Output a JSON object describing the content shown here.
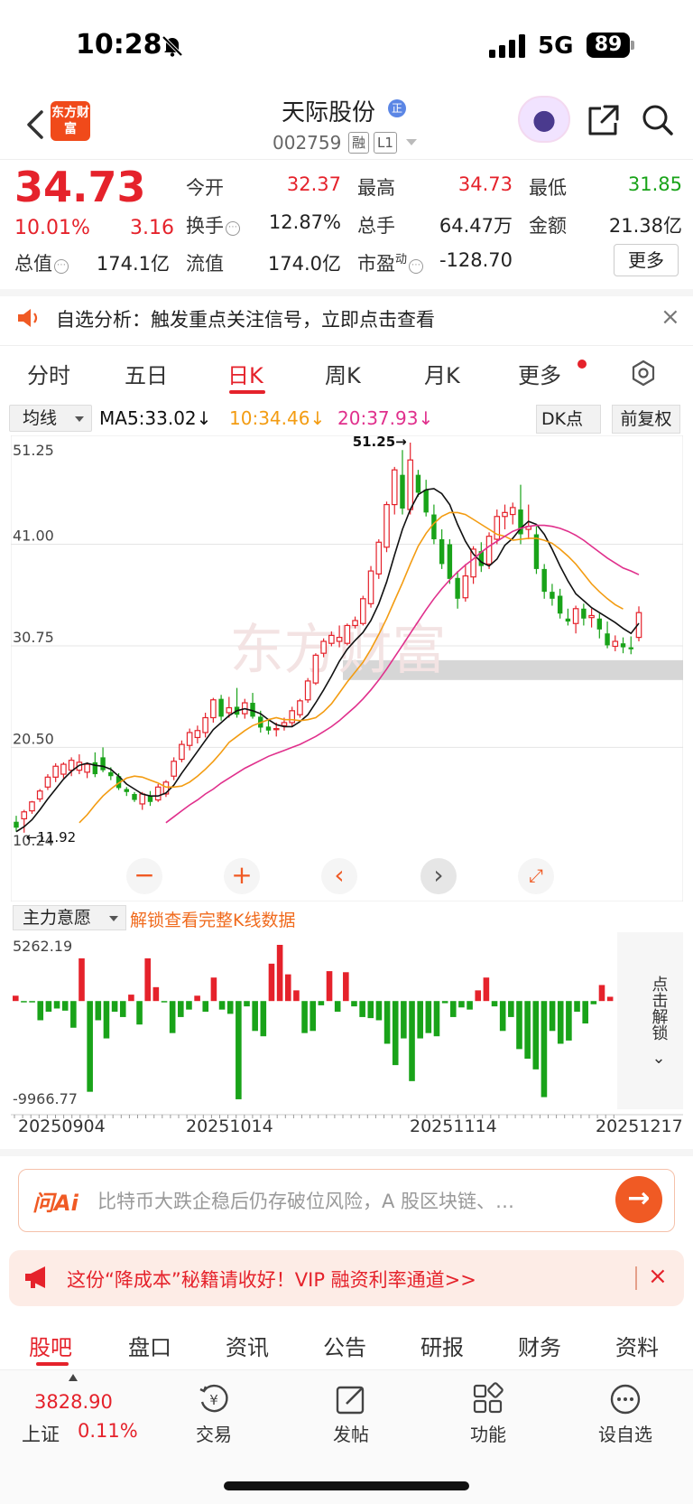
{
  "status_bar": {
    "time": "10:28",
    "network": "5G",
    "battery": "89"
  },
  "header": {
    "logo_text": "东方财富",
    "stock_name": "天际股份",
    "name_badge": "正",
    "stock_code": "002759",
    "tags": [
      "融",
      "L1"
    ]
  },
  "quote": {
    "price": "34.73",
    "change_pct": "10.01%",
    "change": "3.16",
    "fields": [
      {
        "label": "今开",
        "value": "32.37"
      },
      {
        "label": "最高",
        "value": "34.73"
      },
      {
        "label": "最低",
        "value": "31.85"
      },
      {
        "label": "换手",
        "value": "12.87%"
      },
      {
        "label": "总手",
        "value": "64.47万"
      },
      {
        "label": "金额",
        "value": "21.38亿"
      },
      {
        "label": "总值",
        "value": "174.1亿"
      },
      {
        "label": "流值",
        "value": "174.0亿"
      },
      {
        "label": "市盈",
        "label_sup": "动",
        "value": "-128.70"
      }
    ],
    "more_button": "更多"
  },
  "notice": {
    "text": "自选分析：触发重点关注信号，立即点击查看",
    "close": "×"
  },
  "chart_tabs": {
    "items": [
      "分时",
      "五日",
      "日K",
      "周K",
      "月K",
      "更多"
    ],
    "active": "日K"
  },
  "ma_row": {
    "selector": "均线",
    "ma5": "MA5:33.02↓",
    "ma10": "10:34.46↓",
    "ma20": "20:37.93↓",
    "dk_button": "DK点",
    "fq_button": "前复权"
  },
  "colors": {
    "up": "#e5222b",
    "down": "#19a319",
    "ma5": "#111111",
    "ma10": "#f39c12",
    "ma20": "#e0308c",
    "accent": "#f05a24"
  },
  "chart_data": [
    {
      "type": "candlestick",
      "y_ticks": [
        "51.25",
        "41.00",
        "30.75",
        "20.50",
        "10.24"
      ],
      "ylim": [
        10.24,
        51.25
      ],
      "annotations": {
        "high": "51.25→",
        "low": "←11.92"
      },
      "watermark": "东方财富",
      "candles": [
        {
          "o": 13.0,
          "h": 13.6,
          "l": 12.0,
          "c": 12.4
        },
        {
          "o": 13.3,
          "h": 14.2,
          "l": 11.9,
          "c": 14.0
        },
        {
          "o": 14.1,
          "h": 15.1,
          "l": 13.8,
          "c": 15.0
        },
        {
          "o": 15.3,
          "h": 16.3,
          "l": 15.0,
          "c": 16.1
        },
        {
          "o": 16.5,
          "h": 17.8,
          "l": 16.2,
          "c": 17.5
        },
        {
          "o": 17.5,
          "h": 18.9,
          "l": 17.0,
          "c": 18.6
        },
        {
          "o": 17.8,
          "h": 19.0,
          "l": 17.4,
          "c": 18.8
        },
        {
          "o": 18.2,
          "h": 19.5,
          "l": 17.6,
          "c": 19.2
        },
        {
          "o": 18.2,
          "h": 19.8,
          "l": 17.8,
          "c": 19.0
        },
        {
          "o": 18.0,
          "h": 19.0,
          "l": 17.4,
          "c": 18.8
        },
        {
          "o": 19.0,
          "h": 20.0,
          "l": 17.5,
          "c": 17.8
        },
        {
          "o": 19.5,
          "h": 20.5,
          "l": 18.0,
          "c": 18.2
        },
        {
          "o": 18.0,
          "h": 18.5,
          "l": 17.2,
          "c": 17.6
        },
        {
          "o": 17.6,
          "h": 17.9,
          "l": 16.2,
          "c": 16.4
        },
        {
          "o": 16.3,
          "h": 16.5,
          "l": 15.6,
          "c": 16.0
        },
        {
          "o": 15.8,
          "h": 16.0,
          "l": 15.0,
          "c": 15.2
        },
        {
          "o": 14.8,
          "h": 16.0,
          "l": 14.2,
          "c": 15.8
        },
        {
          "o": 15.6,
          "h": 16.1,
          "l": 14.6,
          "c": 15.0
        },
        {
          "o": 15.2,
          "h": 16.8,
          "l": 15.0,
          "c": 16.5
        },
        {
          "o": 15.8,
          "h": 17.2,
          "l": 15.5,
          "c": 17.0
        },
        {
          "o": 17.6,
          "h": 19.5,
          "l": 17.2,
          "c": 19.1
        },
        {
          "o": 19.3,
          "h": 21.2,
          "l": 19.0,
          "c": 20.8
        },
        {
          "o": 20.7,
          "h": 22.4,
          "l": 20.2,
          "c": 22.0
        },
        {
          "o": 21.5,
          "h": 22.7,
          "l": 20.9,
          "c": 22.2
        },
        {
          "o": 22.0,
          "h": 24.0,
          "l": 21.5,
          "c": 23.5
        },
        {
          "o": 23.5,
          "h": 25.5,
          "l": 23.0,
          "c": 25.3
        },
        {
          "o": 25.4,
          "h": 25.8,
          "l": 23.2,
          "c": 23.6
        },
        {
          "o": 24.0,
          "h": 25.6,
          "l": 23.5,
          "c": 24.5
        },
        {
          "o": 24.6,
          "h": 26.5,
          "l": 23.5,
          "c": 23.8
        },
        {
          "o": 23.9,
          "h": 25.4,
          "l": 23.4,
          "c": 25.0
        },
        {
          "o": 25.0,
          "h": 26.0,
          "l": 23.4,
          "c": 23.6
        },
        {
          "o": 23.6,
          "h": 24.2,
          "l": 22.0,
          "c": 22.5
        },
        {
          "o": 22.6,
          "h": 23.3,
          "l": 21.8,
          "c": 22.2
        },
        {
          "o": 22.4,
          "h": 23.0,
          "l": 21.6,
          "c": 22.4
        },
        {
          "o": 22.7,
          "h": 23.5,
          "l": 22.2,
          "c": 23.0
        },
        {
          "o": 23.0,
          "h": 24.6,
          "l": 22.6,
          "c": 24.2
        },
        {
          "o": 23.8,
          "h": 25.4,
          "l": 23.5,
          "c": 25.2
        },
        {
          "o": 25.3,
          "h": 27.5,
          "l": 25.0,
          "c": 27.2
        },
        {
          "o": 27.0,
          "h": 30.0,
          "l": 26.8,
          "c": 29.8
        },
        {
          "o": 30.0,
          "h": 31.5,
          "l": 29.6,
          "c": 31.2
        },
        {
          "o": 31.0,
          "h": 32.2,
          "l": 30.7,
          "c": 31.8
        },
        {
          "o": 31.2,
          "h": 32.8,
          "l": 30.6,
          "c": 31.6
        },
        {
          "o": 31.0,
          "h": 33.0,
          "l": 30.8,
          "c": 32.8
        },
        {
          "o": 32.8,
          "h": 33.7,
          "l": 32.5,
          "c": 33.3
        },
        {
          "o": 33.0,
          "h": 35.8,
          "l": 32.8,
          "c": 35.5
        },
        {
          "o": 35.0,
          "h": 38.8,
          "l": 34.6,
          "c": 38.3
        },
        {
          "o": 38.0,
          "h": 41.5,
          "l": 37.5,
          "c": 41.2
        },
        {
          "o": 40.7,
          "h": 45.3,
          "l": 40.2,
          "c": 45.0
        },
        {
          "o": 45.0,
          "h": 48.8,
          "l": 44.0,
          "c": 48.5
        },
        {
          "o": 48.0,
          "h": 50.5,
          "l": 44.0,
          "c": 44.6
        },
        {
          "o": 44.5,
          "h": 51.25,
          "l": 44.0,
          "c": 49.5
        },
        {
          "o": 48.0,
          "h": 48.5,
          "l": 45.8,
          "c": 46.2
        },
        {
          "o": 46.5,
          "h": 47.5,
          "l": 43.8,
          "c": 44.2
        },
        {
          "o": 44.0,
          "h": 45.0,
          "l": 41.0,
          "c": 41.5
        },
        {
          "o": 41.5,
          "h": 42.5,
          "l": 38.5,
          "c": 39.0
        },
        {
          "o": 41.0,
          "h": 41.5,
          "l": 37.0,
          "c": 37.5
        },
        {
          "o": 37.6,
          "h": 38.3,
          "l": 34.5,
          "c": 35.5
        },
        {
          "o": 35.6,
          "h": 39.0,
          "l": 35.2,
          "c": 37.8
        },
        {
          "o": 37.7,
          "h": 40.8,
          "l": 37.0,
          "c": 40.5
        },
        {
          "o": 40.3,
          "h": 41.2,
          "l": 38.2,
          "c": 38.8
        },
        {
          "o": 39.0,
          "h": 42.2,
          "l": 38.5,
          "c": 41.8
        },
        {
          "o": 41.5,
          "h": 44.5,
          "l": 41.0,
          "c": 43.8
        },
        {
          "o": 43.8,
          "h": 45.0,
          "l": 42.5,
          "c": 44.2
        },
        {
          "o": 44.0,
          "h": 45.2,
          "l": 43.0,
          "c": 44.7
        },
        {
          "o": 44.5,
          "h": 47.0,
          "l": 41.0,
          "c": 42.0
        },
        {
          "o": 42.5,
          "h": 45.0,
          "l": 41.5,
          "c": 42.8
        },
        {
          "o": 42.0,
          "h": 42.8,
          "l": 38.0,
          "c": 38.5
        },
        {
          "o": 38.5,
          "h": 39.0,
          "l": 35.5,
          "c": 36.2
        },
        {
          "o": 36.2,
          "h": 37.0,
          "l": 34.8,
          "c": 35.5
        },
        {
          "o": 35.8,
          "h": 36.5,
          "l": 33.5,
          "c": 34.0
        },
        {
          "o": 33.5,
          "h": 34.5,
          "l": 32.8,
          "c": 33.2
        },
        {
          "o": 33.0,
          "h": 34.8,
          "l": 32.0,
          "c": 34.5
        },
        {
          "o": 34.5,
          "h": 35.0,
          "l": 32.8,
          "c": 33.5
        },
        {
          "o": 33.6,
          "h": 34.5,
          "l": 32.6,
          "c": 33.8
        },
        {
          "o": 33.5,
          "h": 34.0,
          "l": 31.5,
          "c": 32.4
        },
        {
          "o": 32.0,
          "h": 33.2,
          "l": 30.5,
          "c": 30.8
        },
        {
          "o": 30.7,
          "h": 31.8,
          "l": 30.2,
          "c": 31.2
        },
        {
          "o": 31.0,
          "h": 31.6,
          "l": 30.0,
          "c": 30.6
        },
        {
          "o": 30.6,
          "h": 31.7,
          "l": 29.9,
          "c": 30.4
        },
        {
          "o": 31.6,
          "h": 34.73,
          "l": 31.2,
          "c": 34.1
        }
      ],
      "series": [
        {
          "name": "MA5",
          "values": [
            12.0,
            12.5,
            13.2,
            14.2,
            15.3,
            16.3,
            17.3,
            18.1,
            18.7,
            18.9,
            18.7,
            18.6,
            18.3,
            17.6,
            16.8,
            16.3,
            15.8,
            15.6,
            15.6,
            15.9,
            16.7,
            17.9,
            19.0,
            20.1,
            21.2,
            22.3,
            23.0,
            23.7,
            24.2,
            24.4,
            24.2,
            23.9,
            23.3,
            22.8,
            22.6,
            22.6,
            23.1,
            23.8,
            25.0,
            26.3,
            27.7,
            29.2,
            30.4,
            31.3,
            32.1,
            33.3,
            35.0,
            37.2,
            39.9,
            42.5,
            44.5,
            46.0,
            46.5,
            46.6,
            46.1,
            45.0,
            43.0,
            41.3,
            40.0,
            39.2,
            38.8,
            39.5,
            40.9,
            41.6,
            42.6,
            43.3,
            43.0,
            42.0,
            40.5,
            38.8,
            37.3,
            36.0,
            35.3,
            34.6,
            34.1,
            33.6,
            33.1,
            32.5,
            32.0,
            33.02
          ]
        },
        {
          "name": "MA10",
          "values": [
            null,
            null,
            null,
            null,
            null,
            null,
            null,
            null,
            12.9,
            13.7,
            14.7,
            15.6,
            16.3,
            16.9,
            17.4,
            17.6,
            17.5,
            17.2,
            16.9,
            16.5,
            16.5,
            16.6,
            17.0,
            17.6,
            18.3,
            19.1,
            20.0,
            21.0,
            21.6,
            22.2,
            22.7,
            23.0,
            23.3,
            23.5,
            23.3,
            23.3,
            23.2,
            23.3,
            23.5,
            24.1,
            24.9,
            26.0,
            27.1,
            28.1,
            29.1,
            30.4,
            31.9,
            33.5,
            35.3,
            37.1,
            39.0,
            40.8,
            42.1,
            43.1,
            43.8,
            44.2,
            44.2,
            44.0,
            43.5,
            43.0,
            42.5,
            42.0,
            41.8,
            41.4,
            41.5,
            41.6,
            41.6,
            41.4,
            41.1,
            40.5,
            39.8,
            39.0,
            38.0,
            37.0,
            36.2,
            35.5,
            34.9,
            34.46
          ]
        },
        {
          "name": "MA20",
          "values": [
            null,
            null,
            null,
            null,
            null,
            null,
            null,
            null,
            null,
            null,
            null,
            null,
            null,
            null,
            null,
            null,
            null,
            null,
            null,
            12.9,
            13.5,
            14.1,
            14.7,
            15.2,
            15.8,
            16.3,
            16.9,
            17.4,
            17.9,
            18.4,
            18.8,
            19.2,
            19.6,
            19.9,
            20.2,
            20.5,
            20.8,
            21.2,
            21.6,
            22.1,
            22.6,
            23.2,
            23.9,
            24.6,
            25.4,
            26.3,
            27.3,
            28.4,
            29.6,
            30.8,
            32.0,
            33.2,
            34.4,
            35.5,
            36.5,
            37.4,
            38.2,
            38.9,
            39.5,
            40.2,
            40.8,
            41.3,
            41.8,
            42.3,
            42.6,
            42.8,
            42.9,
            42.9,
            42.8,
            42.6,
            42.3,
            41.9,
            41.4,
            40.8,
            40.2,
            39.6,
            39.1,
            38.6,
            38.3,
            37.93
          ]
        }
      ]
    },
    {
      "type": "bar",
      "title": "主力意愿",
      "y_ticks": [
        "5262.19",
        "-9966.77"
      ],
      "ylim": [
        -9966.77,
        5262.19
      ],
      "x_ticks": [
        "20250904",
        "20251014",
        "20251114",
        "20251217"
      ],
      "values": [
        500,
        -100,
        -100,
        -1800,
        -1000,
        -700,
        -900,
        -2500,
        4000,
        -8500,
        -1800,
        -3500,
        -1000,
        -1500,
        600,
        -2200,
        4000,
        1300,
        -100,
        -3000,
        -1500,
        -800,
        500,
        -1000,
        2200,
        -800,
        -1200,
        -9200,
        -500,
        -2800,
        -3300,
        3500,
        5262,
        2500,
        1000,
        -3000,
        -2800,
        -400,
        2800,
        -1000,
        2700,
        -500,
        -1500,
        -1600,
        -1800,
        -4000,
        -6000,
        -3500,
        -7500,
        -3500,
        -3000,
        -3300,
        -200,
        -1500,
        -600,
        -800,
        1000,
        2200,
        -500,
        -2800,
        -1500,
        -4500,
        -5400,
        -6400,
        -9000,
        -2800,
        -4000,
        -3700,
        -1000,
        -2100,
        -300,
        1500,
        400
      ],
      "side_label": "点击解锁"
    }
  ],
  "indicator": {
    "selector": "主力意愿",
    "unlock_text": "解锁查看完整K线数据"
  },
  "ai_bar": {
    "logo": "问Ai",
    "placeholder": "比特币大跌企稳后仍存破位风险，A 股区块链、…",
    "go": "→"
  },
  "vip_banner": {
    "text": "这份“降成本”秘籍请收好！VIP 融资利率通道>>",
    "close": "×"
  },
  "bottom_tabs": {
    "items": [
      "股吧",
      "盘口",
      "资讯",
      "公告",
      "研报",
      "财务",
      "资料"
    ],
    "active": "股吧"
  },
  "dock": {
    "index_value": "3828.90",
    "index_name": "上证",
    "index_pct": "0.11%",
    "items": [
      {
        "label": "交易",
        "icon": "trade-icon"
      },
      {
        "label": "发帖",
        "icon": "post-icon"
      },
      {
        "label": "功能",
        "icon": "functions-icon"
      },
      {
        "label": "设自选",
        "icon": "add-watchlist-icon"
      }
    ]
  }
}
